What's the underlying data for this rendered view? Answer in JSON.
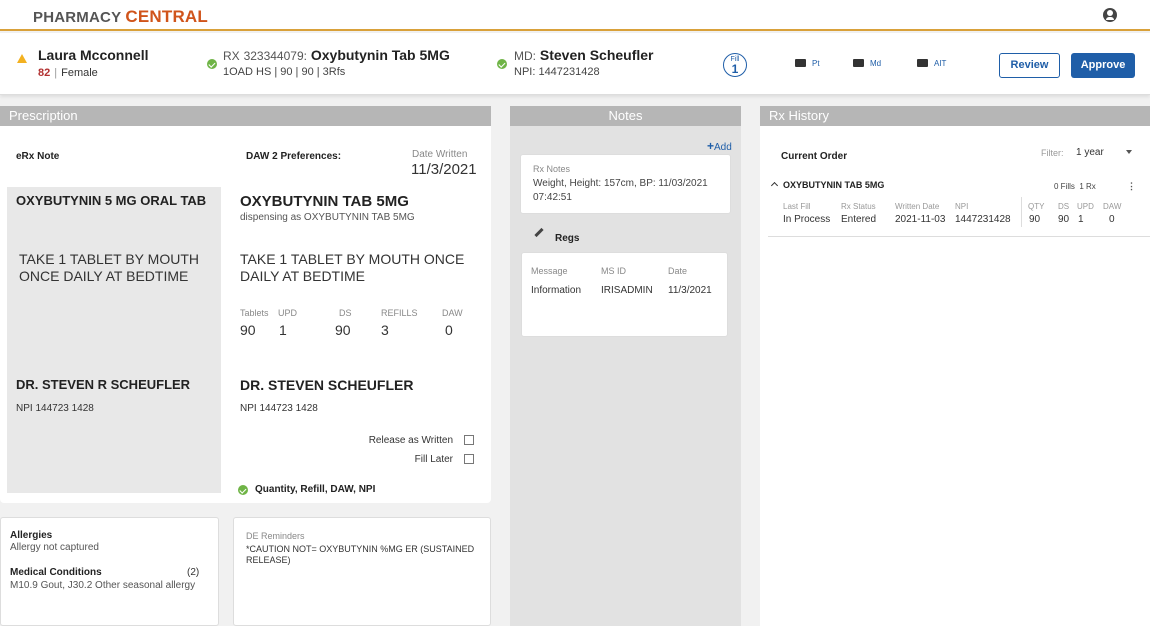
{
  "app": {
    "brand_left": "PHARMACY",
    "brand_right": "CENTRAL"
  },
  "patient": {
    "name": "Laura Mcconnell",
    "age": "82",
    "sex": "Female"
  },
  "rx": {
    "label": "RX",
    "number": "323344079:",
    "drug": "Oxybutynin Tab 5MG",
    "sub": "1OAD HS | 90 | 90 | 3Rfs"
  },
  "md": {
    "label": "MD:",
    "name": "Steven Scheufler",
    "npi": "NPI: 1447231428"
  },
  "fill": {
    "label": "Fill",
    "number": "1"
  },
  "actions": {
    "pt": "Pt",
    "md": "Md",
    "alt": "AIT",
    "review": "Review",
    "approve": "Approve"
  },
  "prescription": {
    "title": "Prescription",
    "erx_note": "eRx Note",
    "daw_pref": "DAW 2 Preferences:",
    "date_written_label": "Date Written",
    "date_written": "11/3/2021",
    "orig": {
      "drug": "OXYBUTYNIN 5 MG ORAL TAB",
      "sig": "TAKE 1 TABLET BY MOUTH ONCE DAILY AT BEDTIME",
      "doctor": "DR. STEVEN R SCHEUFLER",
      "npi": "NPI 144723 1428"
    },
    "disp": {
      "drug": "OXYBUTYNIN TAB 5MG",
      "dispensing": "dispensing as OXYBUTYNIN TAB 5MG",
      "sig": "TAKE 1 TABLET BY MOUTH ONCE DAILY AT BEDTIME",
      "doctor": "DR. STEVEN SCHEUFLER",
      "npi": "NPI 144723 1428"
    },
    "quantities": [
      {
        "label": "Tablets",
        "value": "90"
      },
      {
        "label": "UPD",
        "value": "1"
      },
      {
        "label": "DS",
        "value": "90"
      },
      {
        "label": "REFILLS",
        "value": "3"
      },
      {
        "label": "DAW",
        "value": "0"
      }
    ],
    "release_as_written": "Release as Written",
    "fill_later": "Fill Later",
    "verified": "Quantity, Refill,  DAW, NPI"
  },
  "allergies": {
    "title": "Allergies",
    "value": "Allergy not captured",
    "conditions_title": "Medical Conditions",
    "conditions_count": "(2)",
    "conditions_value": "M10.9 Gout, J30.2 Other seasonal allergy"
  },
  "de_reminders": {
    "title": "DE Reminders",
    "value": "*CAUTION NOT= OXYBUTYNIN %MG ER (SUSTAINED RELEASE)"
  },
  "notes": {
    "title": "Notes",
    "add": "Add",
    "rx_notes_title": "Rx Notes",
    "rx_notes_value": "Weight, Height: 157cm, BP: 11/03/2021 07:42:51",
    "regs_title": "Regs",
    "regs_headers": [
      "Message",
      "MS ID",
      "Date"
    ],
    "regs_row": [
      "Information",
      "IRISADMIN",
      "11/3/2021"
    ]
  },
  "history": {
    "title": "Rx History",
    "current_order": "Current Order",
    "filter_label": "Filter:",
    "filter_value": "1 year",
    "drug": "OXYBUTYNIN  TAB 5MG",
    "fills": "0 Fills",
    "rx_count": "1 Rx",
    "headers": [
      "Last Fill",
      "Rx Status",
      "Written Date",
      "NPI",
      "QTY",
      "DS",
      "UPD",
      "DAW"
    ],
    "row": [
      "In Process",
      "Entered",
      "2021-11-03",
      "1447231428",
      "90",
      "90",
      "1",
      "0"
    ]
  }
}
